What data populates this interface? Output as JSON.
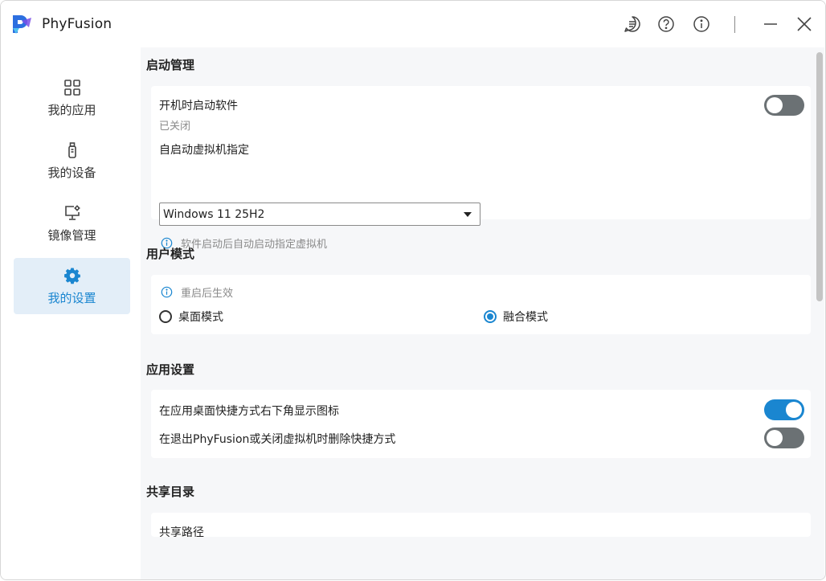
{
  "app": {
    "name": "PhyFusion"
  },
  "sidebar": {
    "items": [
      {
        "label": "我的应用",
        "icon": "grid-icon"
      },
      {
        "label": "我的设备",
        "icon": "usb-device-icon"
      },
      {
        "label": "镜像管理",
        "icon": "monitor-gear-icon"
      },
      {
        "label": "我的设置",
        "icon": "gear-icon"
      }
    ],
    "active": "我的设置"
  },
  "colors": {
    "accent": "#1a86d0",
    "toggle_off": "#6b7174",
    "active_nav_bg": "#e3eef8"
  },
  "sections": {
    "startup": {
      "title": "启动管理",
      "autostart_label": "开机时启动软件",
      "autostart_status": "已关闭",
      "autostart_on": false,
      "vm_label": "自启动虚拟机指定",
      "vm_selected": "Windows 11 25H2",
      "vm_hint": "软件启动后自动启动指定虚拟机"
    },
    "user_mode": {
      "title": "用户模式",
      "hint": "重启后生效",
      "options": [
        "桌面模式",
        "融合模式"
      ],
      "selected": "融合模式"
    },
    "app_settings": {
      "title": "应用设置",
      "show_icon_label": "在应用桌面快捷方式右下角显示图标",
      "show_icon_on": true,
      "delete_shortcut_label": "在退出PhyFusion或关闭虚拟机时删除快捷方式",
      "delete_shortcut_on": false
    },
    "shared_dir": {
      "title": "共享目录",
      "path_label": "共享路径"
    }
  }
}
